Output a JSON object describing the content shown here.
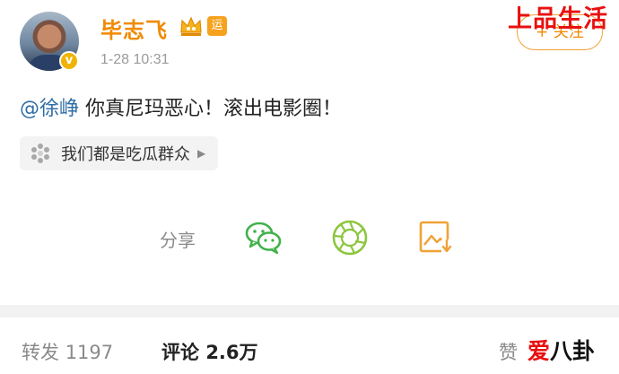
{
  "post": {
    "username": "毕志飞",
    "badge_yun": "运",
    "timestamp": "1-28 10:31",
    "verified_mark": "v",
    "follow_button": "+ 关注",
    "mention": "@徐峥",
    "text": " 你真尼玛恶心！滚出电影圈！",
    "topic_chip": "我们都是吃瓜群众"
  },
  "share": {
    "label": "分享",
    "icons": [
      "wechat-icon",
      "moments-icon",
      "save-image-icon"
    ]
  },
  "stats": {
    "repost_label": "转发",
    "repost_count": "1197",
    "comment_label": "评论",
    "comment_count": "2.6万",
    "like_label": "赞"
  },
  "watermarks": {
    "top": "上品生活",
    "bottom_ai": "爱",
    "bottom_rest": "八卦"
  },
  "colors": {
    "accent": "#f08a00",
    "mention": "#2e6da4",
    "watermark_red": "#e81010"
  }
}
